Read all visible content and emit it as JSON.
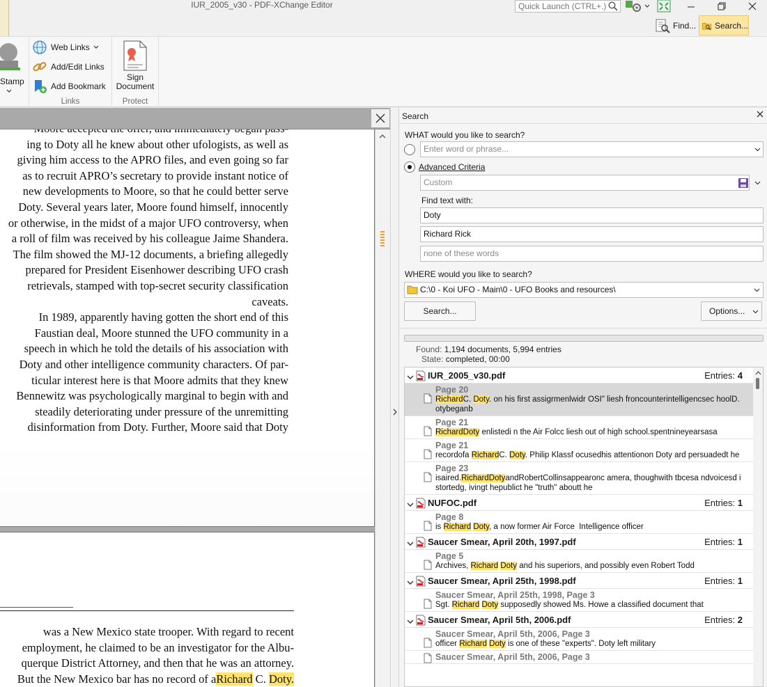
{
  "window": {
    "title": "IUR_2005_v30 - PDF-XChange Editor"
  },
  "quick_launch": {
    "placeholder": "Quick Launch (CTRL+.)"
  },
  "toolbar_tabs": {
    "find": "Find...",
    "search": "Search..."
  },
  "ribbon": {
    "stamp_label": "Stamp",
    "links_group": {
      "label": "Links",
      "web_links": "Web Links",
      "add_edit_links": "Add/Edit Links",
      "add_bookmark": "Add Bookmark"
    },
    "protect_group": {
      "label": "Protect",
      "sign_line1": "Sign",
      "sign_line2": "Document"
    }
  },
  "document": {
    "page1_lines": [
      "Moore accepted the offer, and immediately began pass-",
      "ing to Doty all he knew about other ufologists, as well as",
      "giving him access to the APRO files, and even going so far",
      "as to recruit APRO’s secretary to provide instant notice of",
      "new developments to Moore, so that he could better serve",
      "Doty. Several years later, Moore found himself, innocently",
      "or otherwise, in the midst of a major UFO controversy, when",
      "a roll of film was received by his colleague Jaime Shandera.",
      "The film showed the MJ-12 documents, a briefing allegedly",
      "prepared for President Eisenhower describing UFO crash",
      "retrievals, stamped with top-secret security classification",
      "caveats.",
      "In 1989, apparently having gotten the short end of this",
      "Faustian deal, Moore stunned the UFO community in a",
      "speech in which he told the details of his association with",
      "Doty and other intelligence community characters. Of par-",
      "ticular interest here is that Moore admits that they knew",
      "Bennewitz was psychologically marginal to begin with and",
      "steadily deteriorating under pressure of the unremitting",
      "disinformation from Doty. Further, Moore said that Doty"
    ],
    "page2_lines": [
      "was a New Mexico state trooper. With regard to recent",
      "employment, he claimed to be an investigator for the Albu-",
      "querque District Attorney, and then that he was an attorney.",
      "But the New Mexico bar has no record of a "
    ],
    "page2_hl_richard": "Richard",
    "page2_mid": " C. ",
    "page2_hl_doty": "Doty."
  },
  "search": {
    "panel_title": "Search",
    "what_label": "WHAT would you like to search?",
    "phrase_placeholder": "Enter word or phrase...",
    "advanced_label": "Advanced Criteria",
    "criteria_value": "Custom",
    "find_text_label": "Find text with:",
    "term1": "Doty",
    "term2": "Richard Rick",
    "none_placeholder": "none of these words",
    "where_label": "WHERE would you like to search?",
    "where_value": "C:\\0 - Koi UFO - Main\\0 - UFO Books and resources\\",
    "search_button": "Search...",
    "options_button": "Options...",
    "found_label": "Found:",
    "found_value": "1,194 documents, 5,994 entries",
    "state_label": "State:",
    "state_value": "completed, 00:00",
    "entries_label": "Entries:"
  },
  "results": [
    {
      "file": "IUR_2005_v30.pdf",
      "entries": "4",
      "items": [
        {
          "page": "Page 20",
          "selected": true,
          "parts": [
            [
              "Richard",
              true
            ],
            [
              "C. ",
              false
            ],
            [
              "Doty",
              true
            ],
            [
              ". on his first assigrmenlwidr OSI\" liesh froncounterintelligencsec hoolD.otybeganb",
              false
            ]
          ]
        },
        {
          "page": "Page 21",
          "selected": false,
          "parts": [
            [
              "RichardDoty",
              true
            ],
            [
              " enlistedi n the Air Folcc liesh out of high school.spentnineyearsasa",
              false
            ]
          ]
        },
        {
          "page": "Page 21",
          "selected": false,
          "parts": [
            [
              "recordofa ",
              false
            ],
            [
              "Richard",
              true
            ],
            [
              "C. ",
              false
            ],
            [
              "Doty",
              true
            ],
            [
              ". Philip Klassf ocusedhis attentionon Doty ard persuadedt he",
              false
            ]
          ]
        },
        {
          "page": "Page 23",
          "selected": false,
          "parts": [
            [
              "isaired.",
              false
            ],
            [
              "RichardDoty",
              true
            ],
            [
              "andRobertCollinsappearonc amera, thoughwith tbcesa ndvoicesd istortedg, ivingt hepublict he \"truth\" aboutt he",
              false
            ]
          ]
        }
      ]
    },
    {
      "file": "NUFOC.pdf",
      "entries": "1",
      "items": [
        {
          "page": "Page 8",
          "selected": false,
          "parts": [
            [
              "is ",
              false
            ],
            [
              "Richard",
              true
            ],
            [
              " ",
              false
            ],
            [
              "Doty",
              true
            ],
            [
              ", a now former Air Force  Intelligence officer",
              false
            ]
          ]
        }
      ]
    },
    {
      "file": "Saucer Smear, April 20th, 1997.pdf",
      "entries": "1",
      "items": [
        {
          "page": "Page 5",
          "selected": false,
          "parts": [
            [
              "Archives, ",
              false
            ],
            [
              "Richard",
              true
            ],
            [
              " ",
              false
            ],
            [
              "Doty",
              true
            ],
            [
              " and his superiors, and possibly even Robert Todd",
              false
            ]
          ]
        }
      ]
    },
    {
      "file": "Saucer Smear, April 25th, 1998.pdf",
      "entries": "1",
      "items": [
        {
          "page": "Saucer Smear, April 25th, 1998, Page 3",
          "selected": false,
          "parts": [
            [
              "Sgt. ",
              false
            ],
            [
              "Richard",
              true
            ],
            [
              " ",
              false
            ],
            [
              "Doty",
              true
            ],
            [
              " supposedly showed Ms. Howe a classified document that",
              false
            ]
          ]
        }
      ]
    },
    {
      "file": "Saucer Smear, April 5th, 2006.pdf",
      "entries": "2",
      "items": [
        {
          "page": "Saucer Smear, April 5th, 2006, Page 3",
          "selected": false,
          "parts": [
            [
              "officer ",
              false
            ],
            [
              "Richard",
              true
            ],
            [
              " ",
              false
            ],
            [
              "Doty",
              true
            ],
            [
              " is one of these \"experts\". Doty left military",
              false
            ]
          ]
        },
        {
          "page": "Saucer Smear, April 5th, 2006, Page 3",
          "selected": false,
          "parts": []
        }
      ]
    }
  ],
  "colors": {
    "highlight": "#ffe36b",
    "selected_row": "#d8d8d8",
    "search_tab": "#fbe6a4"
  }
}
